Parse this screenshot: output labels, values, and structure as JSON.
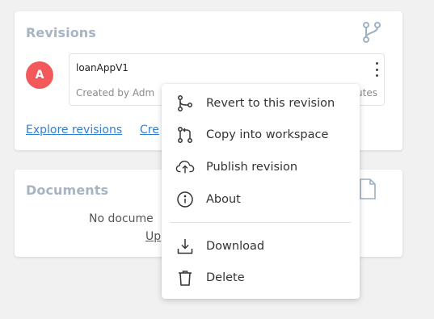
{
  "revisions": {
    "title": "Revisions",
    "header_icon": "branch-icon",
    "avatar_initial": "A",
    "avatar_color": "#f3595b",
    "revision": {
      "name": "loanAppV1",
      "meta": "Created by Adm",
      "meta_tail": "utes"
    },
    "links": {
      "explore": "Explore revisions",
      "create": "Cre"
    }
  },
  "documents": {
    "title": "Documents",
    "header_icon": "file-icon",
    "empty_text": "No docume",
    "upload_link": "Up"
  },
  "context_menu": {
    "items": [
      {
        "label": "Revert to this revision",
        "icon": "branch-revert-icon"
      },
      {
        "label": "Copy into workspace",
        "icon": "merge-copy-icon"
      },
      {
        "label": "Publish revision",
        "icon": "cloud-upload-icon"
      },
      {
        "label": "About",
        "icon": "info-icon"
      },
      {
        "label": "Download",
        "icon": "download-icon"
      },
      {
        "label": "Delete",
        "icon": "trash-icon"
      }
    ]
  },
  "colors": {
    "background": "#f1f1f1",
    "card_title": "#a6b4c3",
    "link": "#2f80d4"
  }
}
